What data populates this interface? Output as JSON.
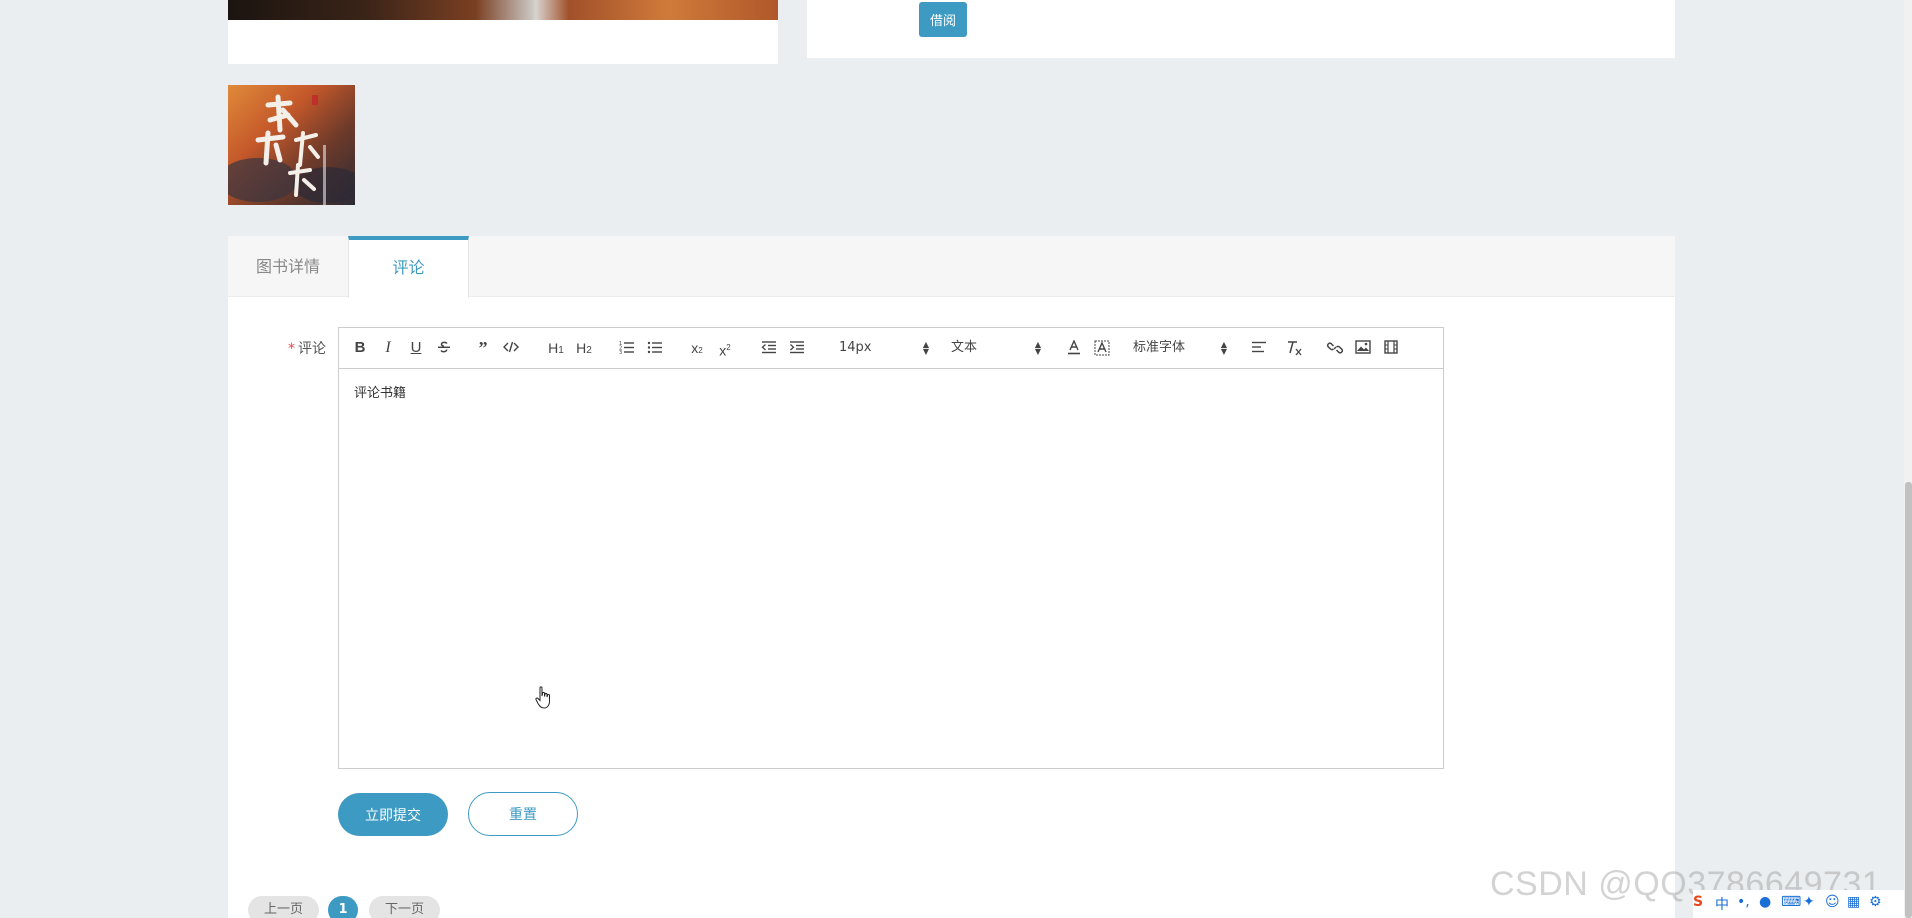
{
  "book": {
    "borrow_label": "借阅"
  },
  "tabs": [
    {
      "label": "图书详情"
    },
    {
      "label": "评论"
    }
  ],
  "comment_form": {
    "required_mark": "*",
    "label": "评论",
    "editor": {
      "font_size_value": "14px",
      "header_value": "文本",
      "font_family_value": "标准字体",
      "content": "评论书籍"
    },
    "submit_label": "立即提交",
    "reset_label": "重置"
  },
  "pagination": {
    "prev_label": "上一页",
    "current_page": "1",
    "next_label": "下一页"
  },
  "watermark": "CSDN @QQ3786649731",
  "tray": {
    "ime_mode": "中"
  },
  "colors": {
    "accent": "#3d9ac3",
    "page_bg": "#ebeef0",
    "required": "#e44444"
  },
  "icons": [
    "bold-icon",
    "italic-icon",
    "underline-icon",
    "strikethrough-icon",
    "blockquote-icon",
    "code-block-icon",
    "header-1-icon",
    "header-2-icon",
    "ordered-list-icon",
    "bullet-list-icon",
    "subscript-icon",
    "superscript-icon",
    "outdent-icon",
    "indent-icon",
    "font-color-icon",
    "background-color-icon",
    "align-icon",
    "clear-format-icon",
    "link-icon",
    "image-icon",
    "video-icon"
  ]
}
